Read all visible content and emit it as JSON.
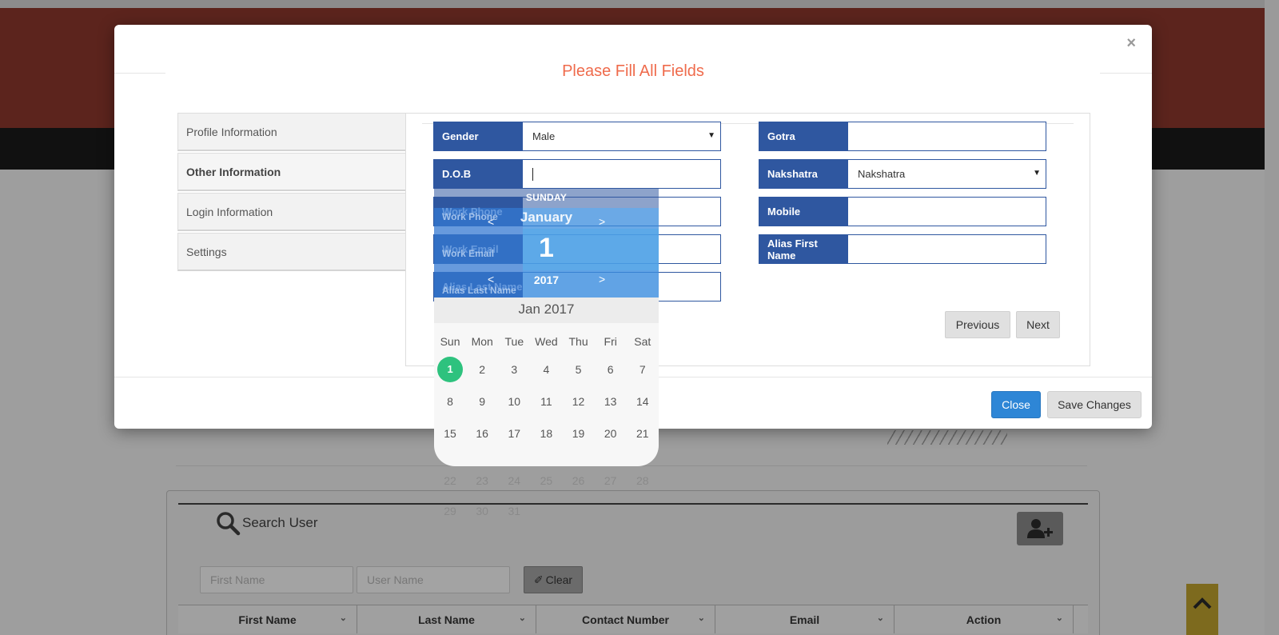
{
  "background": {
    "search_panel": {
      "title": "Search User",
      "first_name_placeholder": "First Name",
      "user_name_placeholder": "User Name",
      "clear_label": "Clear",
      "columns": [
        "First Name",
        "Last Name",
        "Contact Number",
        "Email",
        "Action"
      ]
    }
  },
  "modal": {
    "close_x": "×",
    "title": "Please Fill All Fields",
    "tabs": [
      {
        "label": "Profile Information",
        "active": false
      },
      {
        "label": "Other Information",
        "active": true
      },
      {
        "label": "Login Information",
        "active": false
      },
      {
        "label": "Settings",
        "active": false
      }
    ],
    "fields": {
      "gender": {
        "label": "Gender",
        "value": "Male"
      },
      "gotra": {
        "label": "Gotra",
        "value": ""
      },
      "dob": {
        "label": "D.O.B",
        "value": ""
      },
      "nakshatra": {
        "label": "Nakshatra",
        "value": "Nakshatra"
      },
      "work_phone": {
        "label": "Work Phone",
        "value": ""
      },
      "mobile": {
        "label": "Mobile",
        "value": ""
      },
      "work_email": {
        "label": "Work Email",
        "value": ""
      },
      "alias_first_name": {
        "label": "Alias First Name",
        "value": ""
      },
      "alias_last_name": {
        "label": "Alias Last Name",
        "value": ""
      }
    },
    "previous_label": "Previous",
    "next_label": "Next",
    "close_label": "Close",
    "save_label": "Save Changes"
  },
  "datepicker": {
    "day_name": "SUNDAY",
    "month": "January",
    "day": "1",
    "year": "2017",
    "prev_arrow": "<",
    "next_arrow": ">",
    "month_header": "Jan 2017",
    "weekdays": [
      "Sun",
      "Mon",
      "Tue",
      "Wed",
      "Thu",
      "Fri",
      "Sat"
    ],
    "weeks": [
      [
        "1",
        "2",
        "3",
        "4",
        "5",
        "6",
        "7"
      ],
      [
        "8",
        "9",
        "10",
        "11",
        "12",
        "13",
        "14"
      ],
      [
        "15",
        "16",
        "17",
        "18",
        "19",
        "20",
        "21"
      ]
    ],
    "weeks_overflow": [
      [
        "22",
        "23",
        "24",
        "25",
        "26",
        "27",
        "28"
      ],
      [
        "29",
        "30",
        "31"
      ]
    ],
    "selected_day": "1"
  },
  "colors": {
    "field_label_bg": "#2f57a0",
    "title": "#ef6b4c",
    "primary_button": "#2e86d6",
    "selected_day": "#2ec27e"
  }
}
